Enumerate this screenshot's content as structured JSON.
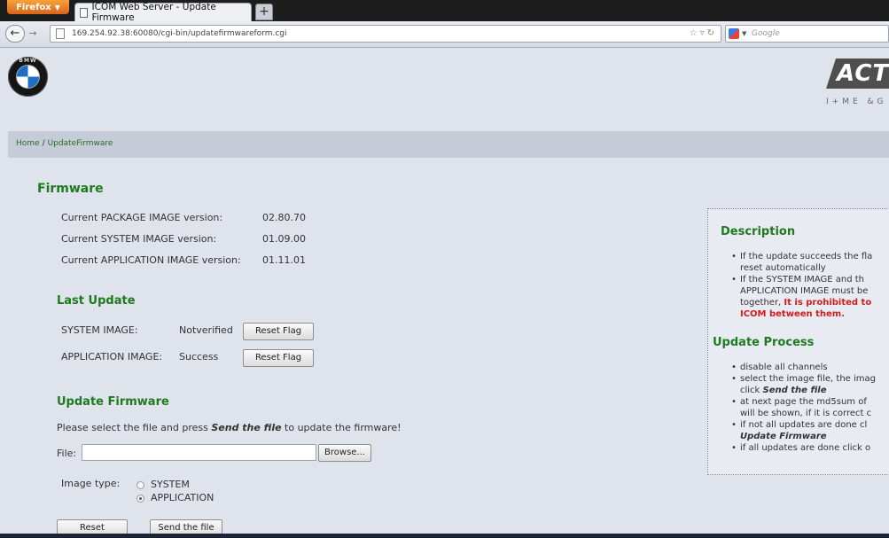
{
  "browser": {
    "menu_label": "Firefox",
    "tab_title": "ICOM Web Server - Update Firmware",
    "new_tab_label": "+",
    "url": "169.254.92.38:60080/cgi-bin/updatefirmwareform.cgi",
    "search_placeholder": "Google"
  },
  "header": {
    "bmw_letters": "BMW",
    "brand_logo_text": "ACT",
    "brand_sub_text": "I+ME &G"
  },
  "breadcrumb": {
    "home": "Home",
    "separator": "/",
    "current": "UpdateFirmware"
  },
  "firmware": {
    "title": "Firmware",
    "rows": [
      {
        "label": "Current PACKAGE IMAGE version:",
        "value": "02.80.70"
      },
      {
        "label": "Current SYSTEM IMAGE version:",
        "value": "01.09.00"
      },
      {
        "label": "Current APPLICATION IMAGE version:",
        "value": "01.11.01"
      }
    ]
  },
  "last_update": {
    "title": "Last Update",
    "rows": [
      {
        "label": "SYSTEM IMAGE:",
        "status": "Notverified",
        "button": "Reset Flag"
      },
      {
        "label": "APPLICATION IMAGE:",
        "status": "Success",
        "button": "Reset Flag"
      }
    ]
  },
  "update_firmware": {
    "title": "Update Firmware",
    "instruction_pre": "Please select the file and press ",
    "instruction_em": "Send the file",
    "instruction_post": " to update the firmware!",
    "file_label": "File:",
    "file_value": "",
    "browse_button": "Browse...",
    "image_type_label": "Image type:",
    "options": [
      {
        "label": "SYSTEM",
        "selected": false
      },
      {
        "label": "APPLICATION",
        "selected": true
      }
    ],
    "reset_button": "Reset",
    "send_button": "Send the file"
  },
  "description": {
    "title": "Description",
    "item1_line1": "If the update succeeds the fla",
    "item1_line2": "reset automatically",
    "item2_line1": "If the SYSTEM IMAGE and th",
    "item2_line2": "APPLICATION IMAGE must be",
    "item2_line3_pre": "together, ",
    "item2_line3_red": "It is prohibited to",
    "item2_line4_red": "ICOM between them.",
    "process_title": "Update Process",
    "p1": "disable all channels",
    "p2_line1": "select the image file, the imag",
    "p2_line2_pre": "click ",
    "p2_line2_em": "Send the file",
    "p3_line1": "at next page the md5sum of",
    "p3_line2": "will be shown, if it is correct c",
    "p4_line1": "if not all updates are done cl",
    "p4_line2_em": "Update Firmware",
    "p5": "if all updates are done click o"
  }
}
